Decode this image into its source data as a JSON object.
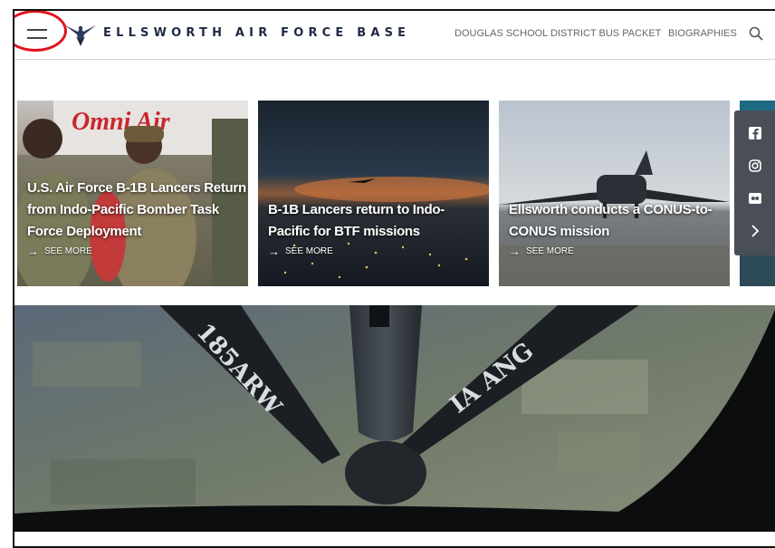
{
  "header": {
    "site_title": "ELLSWORTH AIR FORCE BASE",
    "nav": [
      "DOUGLAS SCHOOL DISTRICT BUS PACKET",
      "BIOGRAPHIES"
    ],
    "icons": {
      "menu": "hamburger-menu-icon",
      "logo": "air-force-wings-logo",
      "search": "search-icon"
    }
  },
  "cards": [
    {
      "title_lines": [
        "U.S. Air Force B-1B Lancers Return",
        "from Indo-Pacific Bomber Task",
        "Force Deployment"
      ],
      "see_more": "SEE MORE"
    },
    {
      "title_lines": [
        "B-1B Lancers return to Indo-",
        "Pacific for BTF missions"
      ],
      "see_more": "SEE MORE"
    },
    {
      "title_lines": [
        "Ellsworth conducts a CONUS-to-",
        "CONUS mission"
      ],
      "see_more": "SEE MORE"
    }
  ],
  "social": [
    "facebook-icon",
    "instagram-icon",
    "flickr-icon",
    "chevron-right-icon"
  ],
  "hero_text": "185ARW IA ANG",
  "colors": {
    "annotation": "#e0141e",
    "brand_navy": "#1f2a44",
    "social_bar": "#4a4f57"
  }
}
